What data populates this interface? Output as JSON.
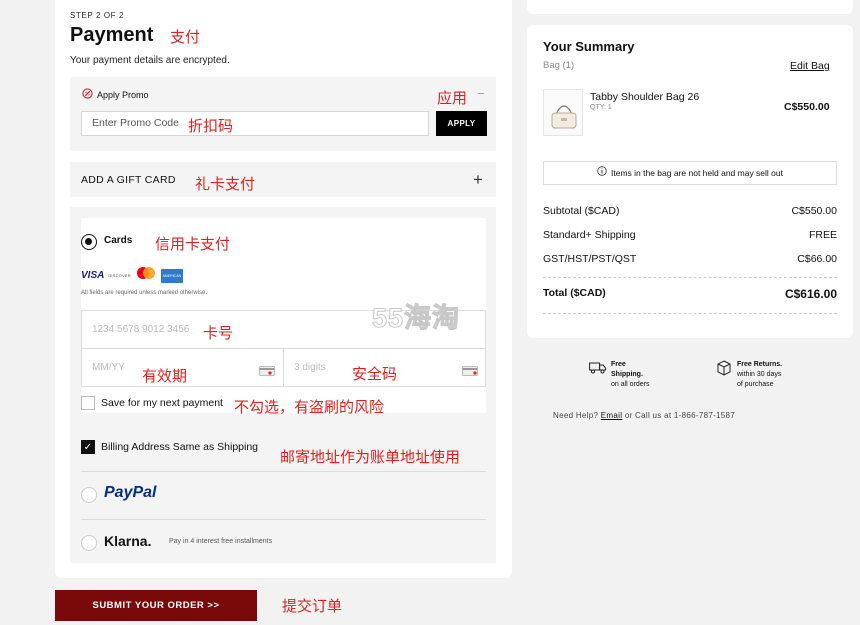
{
  "checkout": {
    "step": "STEP 2 OF 2",
    "title": "Payment",
    "subtitle": "Your payment details are encrypted."
  },
  "promo": {
    "label": "Apply Promo",
    "placeholder": "Enter Promo Code",
    "apply_label": "APPLY",
    "collapse_symbol": "−"
  },
  "gift_card": {
    "label": "ADD A GIFT CARD",
    "expand_symbol": "+"
  },
  "payment": {
    "cards_label": "Cards",
    "card_brands": [
      "VISA",
      "DISCOVER",
      "mastercard",
      "AMERICAN EXPRESS"
    ],
    "required_note": "All fields are required unless marked otherwise.",
    "card_number_placeholder": "1234 5678 9012 3456",
    "expiry_placeholder": "MM/YY",
    "cvv_placeholder": "3 digits",
    "save_label": "Save for my next payment",
    "save_checked": false,
    "billing_label": "Billing Address Same as Shipping",
    "billing_checked": true,
    "paypal_label": "PayPal",
    "klarna_label": "Klarna.",
    "klarna_note": "Pay in 4 interest free installments",
    "selected_method": "cards"
  },
  "submit_label": "SUBMIT YOUR ORDER >>",
  "annotations": {
    "payment": "支付",
    "apply": "应用",
    "promo_code": "折扣码",
    "gift_card": "礼卡支付",
    "credit_card": "信用卡支付",
    "card_number": "卡号",
    "expiry": "有效期",
    "cvv": "安全码",
    "save_warning": "不勾选，有盗刷的风险",
    "billing": "邮寄地址作为账单地址使用",
    "submit": "提交订单"
  },
  "watermark": "55海淘",
  "summary": {
    "title": "Your Summary",
    "bag_count": "Bag (1)",
    "edit_label": "Edit Bag",
    "item": {
      "name": "Tabby Shoulder Bag 26",
      "qty": "QTY: 1",
      "price": "C$550.00"
    },
    "notice": "Items in the bag are not held and may sell out",
    "rows": [
      {
        "label": "Subtotal ($CAD)",
        "value": "C$550.00"
      },
      {
        "label": "Standard+ Shipping",
        "value": "FREE"
      },
      {
        "label": "GST/HST/PST/QST",
        "value": "C$66.00"
      }
    ],
    "total": {
      "label": "Total ($CAD)",
      "value": "C$616.00"
    }
  },
  "perks": {
    "shipping": {
      "title": "Free",
      "title2": "Shipping.",
      "note": "on all orders"
    },
    "returns": {
      "title": "Free Returns.",
      "line2": "within 30 days",
      "line3": "of purchase"
    }
  },
  "help": {
    "prefix": "Need Help? ",
    "email": "Email",
    "suffix": " or Call us at 1-866-787-1587"
  },
  "colors": {
    "submit_bg": "#7a0a0a",
    "annotation": "#e0201e"
  }
}
